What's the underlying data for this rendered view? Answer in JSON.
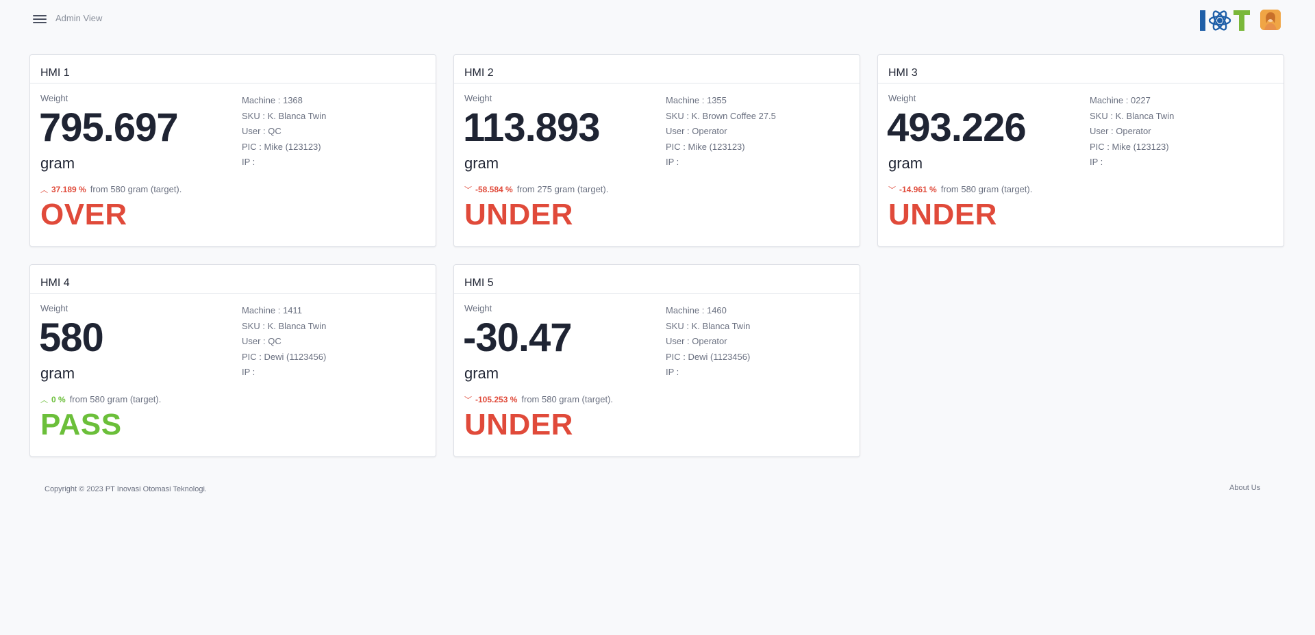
{
  "header": {
    "view_label": "Admin View",
    "logo_text": "IoT"
  },
  "cards": [
    {
      "title": "HMI 1",
      "weight_label": "Weight",
      "weight": "795.697",
      "unit": "gram",
      "delta_pct": "37.189 %",
      "delta_dir": "up",
      "delta_text": "from 580 gram (target).",
      "status": "OVER",
      "status_color": "#e04a3a",
      "pct_color": "#e04a3a",
      "machine": "Machine : 1368",
      "sku": "SKU : K. Blanca Twin",
      "user": "User : QC",
      "pic": "PIC : Mike (123123)",
      "ip": "IP :"
    },
    {
      "title": "HMI 2",
      "weight_label": "Weight",
      "weight": "113.893",
      "unit": "gram",
      "delta_pct": "-58.584 %",
      "delta_dir": "down",
      "delta_text": "from 275 gram (target).",
      "status": "UNDER",
      "status_color": "#e04a3a",
      "pct_color": "#e04a3a",
      "machine": "Machine : 1355",
      "sku": "SKU : K. Brown Coffee 27.5",
      "user": "User : Operator",
      "pic": "PIC : Mike (123123)",
      "ip": "IP :"
    },
    {
      "title": "HMI 3",
      "weight_label": "Weight",
      "weight": "493.226",
      "unit": "gram",
      "delta_pct": "-14.961 %",
      "delta_dir": "down",
      "delta_text": "from 580 gram (target).",
      "status": "UNDER",
      "status_color": "#e04a3a",
      "pct_color": "#e04a3a",
      "machine": "Machine : 0227",
      "sku": "SKU : K. Blanca Twin",
      "user": "User : Operator",
      "pic": "PIC : Mike (123123)",
      "ip": "IP :"
    },
    {
      "title": "HMI 4",
      "weight_label": "Weight",
      "weight": "580",
      "unit": "gram",
      "delta_pct": "0 %",
      "delta_dir": "up",
      "delta_text": "from 580 gram (target).",
      "status": "PASS",
      "status_color": "#6bbf3a",
      "pct_color": "#6bbf3a",
      "machine": "Machine : 1411",
      "sku": "SKU : K. Blanca Twin",
      "user": "User : QC",
      "pic": "PIC : Dewi (1123456)",
      "ip": "IP :"
    },
    {
      "title": "HMI 5",
      "weight_label": "Weight",
      "weight": "-30.47",
      "unit": "gram",
      "delta_pct": "-105.253 %",
      "delta_dir": "down",
      "delta_text": "from 580 gram (target).",
      "status": "UNDER",
      "status_color": "#e04a3a",
      "pct_color": "#e04a3a",
      "machine": "Machine : 1460",
      "sku": "SKU : K. Blanca Twin",
      "user": "User : Operator",
      "pic": "PIC : Dewi (1123456)",
      "ip": "IP :"
    }
  ],
  "footer": {
    "copyright": "Copyright © 2023 PT Inovasi Otomasi Teknologi.",
    "about": "About Us"
  }
}
